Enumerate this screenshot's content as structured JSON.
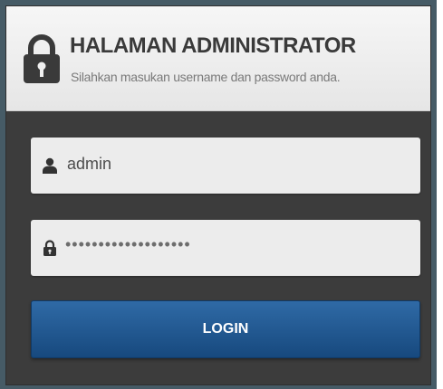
{
  "header": {
    "title": "HALAMAN ADMINISTRATOR",
    "subtitle": "Silahkan masukan username dan password anda.",
    "icon": "lock-icon"
  },
  "form": {
    "username": {
      "value": "admin",
      "icon": "user-icon"
    },
    "password": {
      "value": "•••••••••••••••••••",
      "icon": "padlock-icon"
    },
    "login_label": "LOGIN"
  },
  "colors": {
    "frame": "#465b66",
    "panel": "#3c3c3c",
    "header_bg": "#f0f0f0",
    "field_bg": "#ececec",
    "button_top": "#2f6aa6",
    "button_bottom": "#17497e"
  }
}
